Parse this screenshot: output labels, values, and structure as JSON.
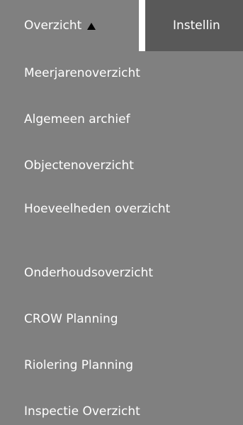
{
  "tabs": {
    "overzicht_label": "Overzicht",
    "instellingen_label": "Instellin"
  },
  "menu": {
    "items": [
      {
        "label": "Meerjarenoverzicht"
      },
      {
        "label": "Algemeen archief"
      },
      {
        "label": "Objectenoverzicht"
      },
      {
        "label": "Hoeveelheden overzicht"
      },
      {
        "label": "Onderhoudsoverzicht"
      },
      {
        "label": "CROW Planning"
      },
      {
        "label": "Riolering Planning"
      },
      {
        "label": "Inspectie Overzicht"
      }
    ]
  },
  "colors": {
    "menu_background": "#808080",
    "inactive_tab_background": "#595959",
    "text": "#ffffff",
    "caret": "#000000"
  },
  "icons": {
    "dropdown_state": "caret-up-icon"
  }
}
